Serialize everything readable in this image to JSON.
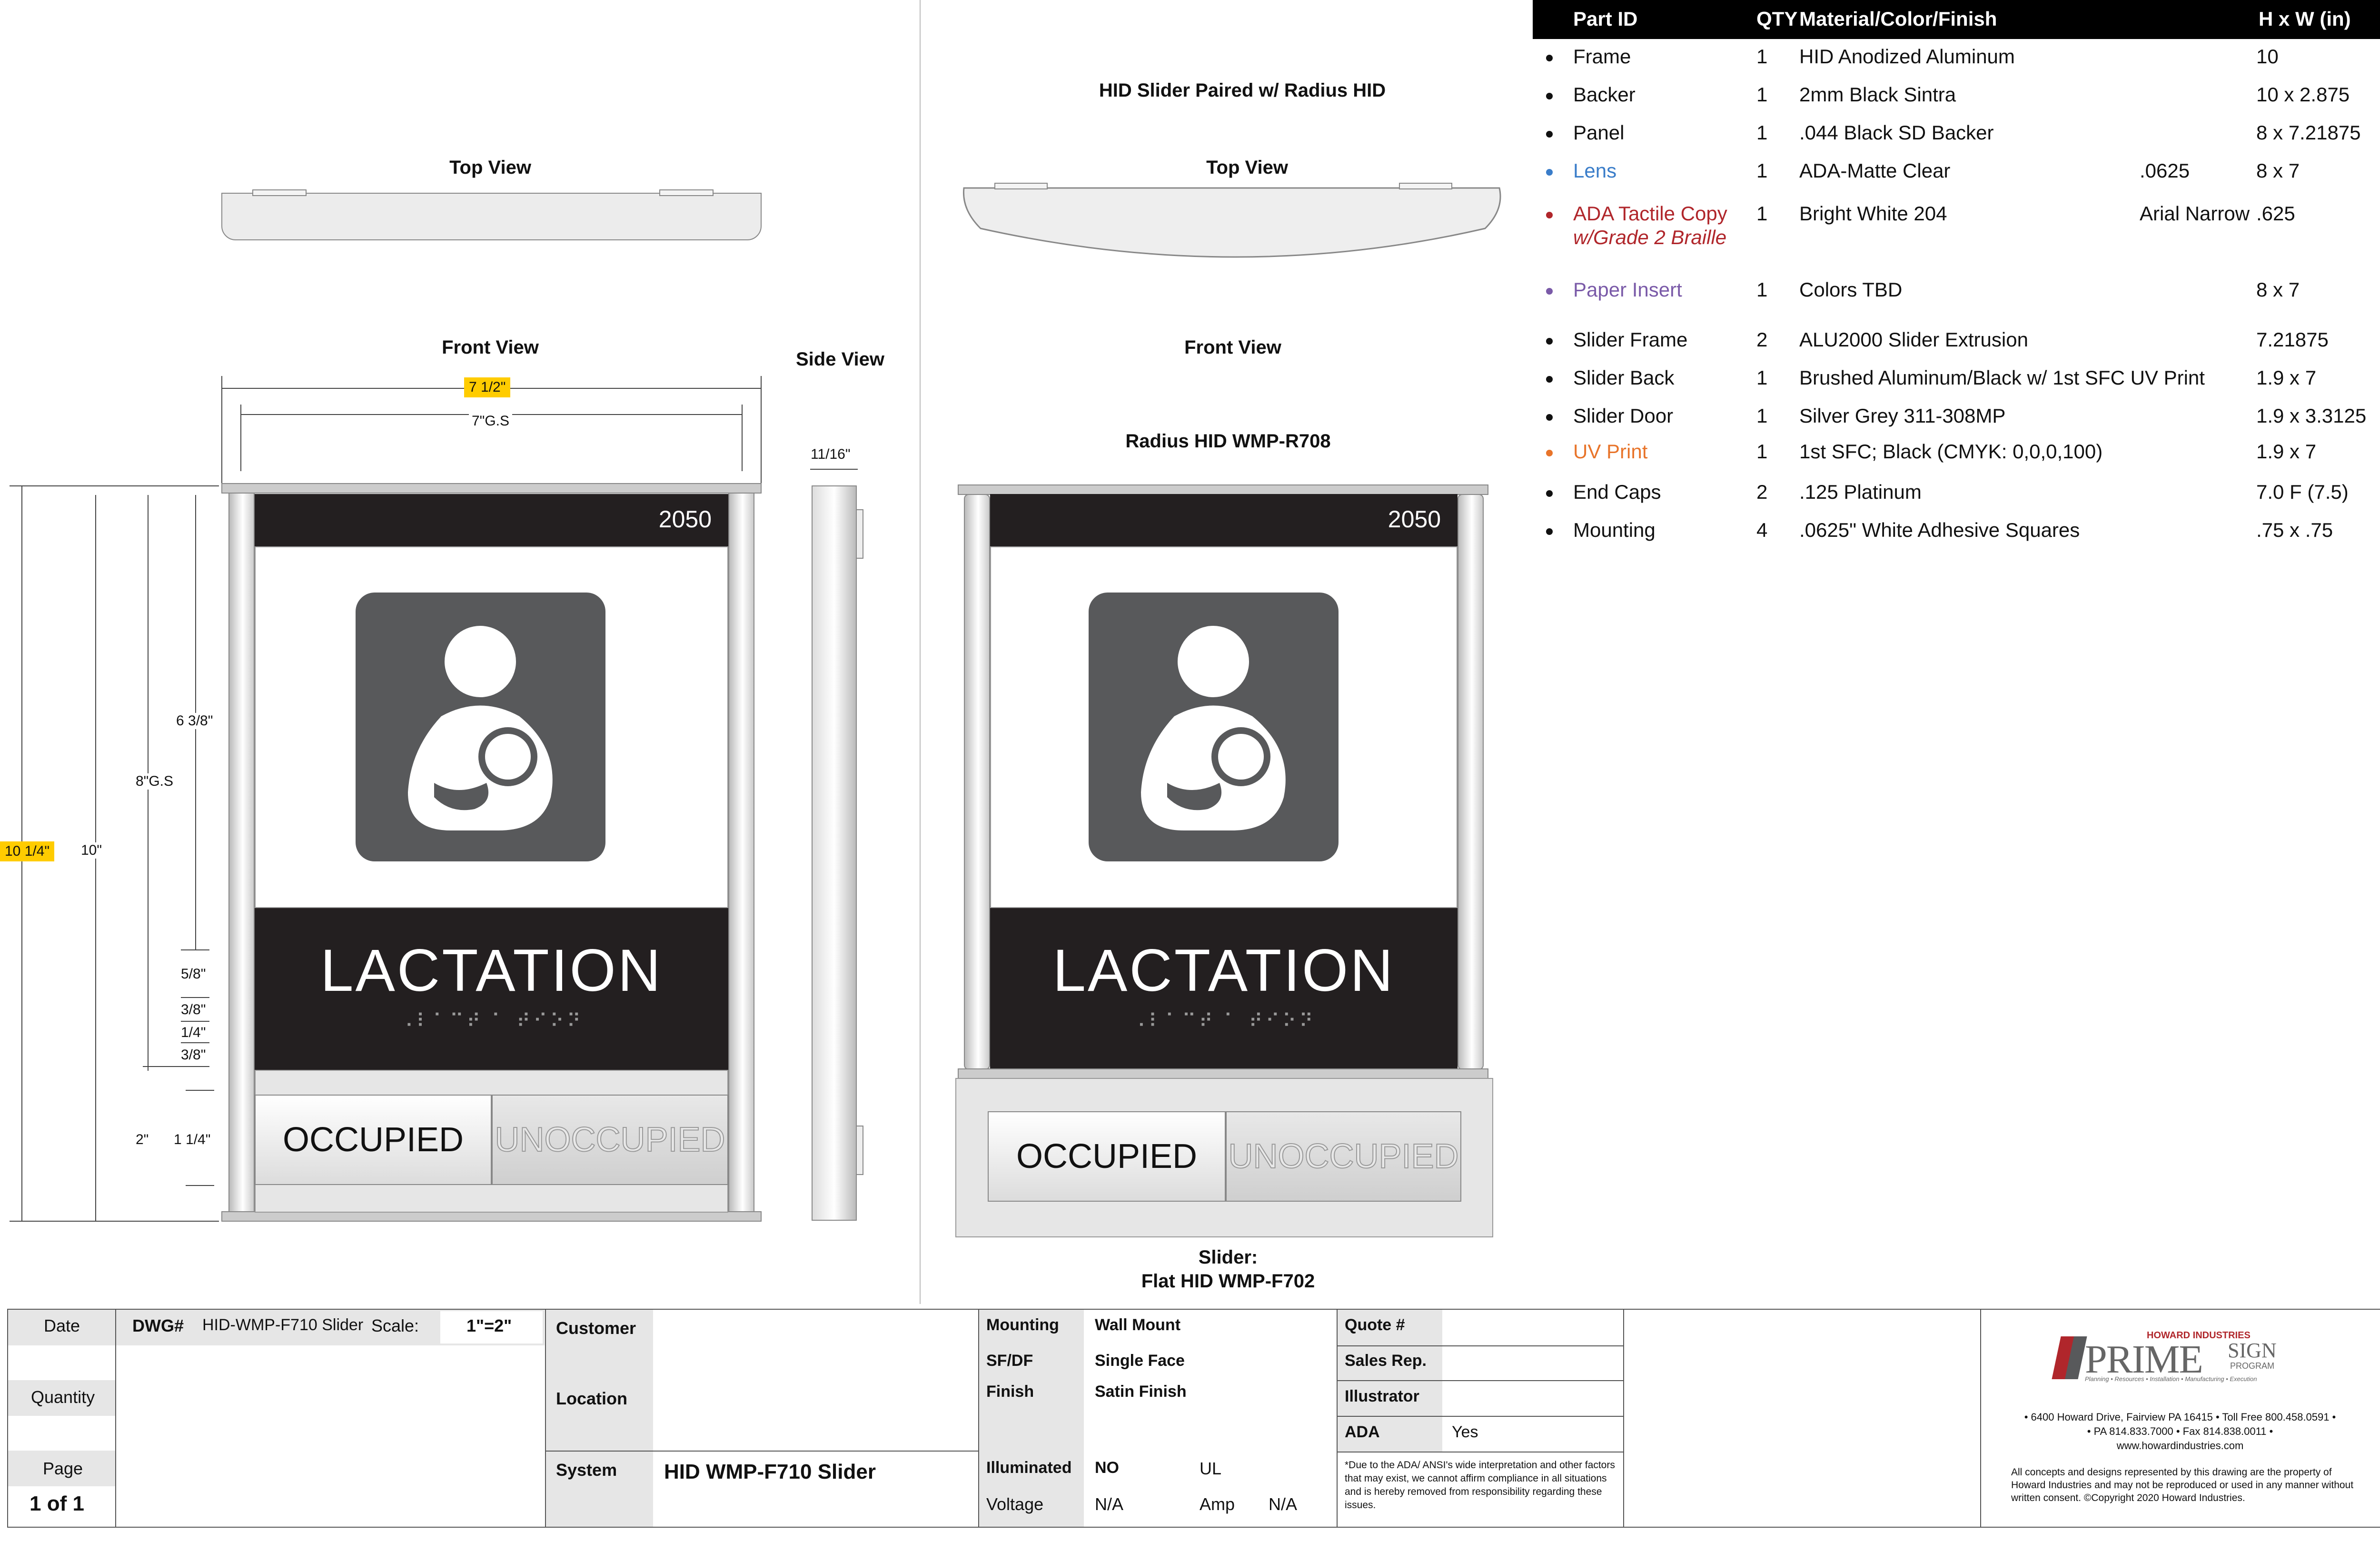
{
  "drawing": {
    "top_view_left": "Top View",
    "front_view_left": "Front View",
    "side_view": "Side View",
    "paired_title": "HID Slider Paired w/ Radius HID",
    "top_view_right": "Top View",
    "front_view_right": "Front View",
    "radius_title": "Radius HID WMP-R708",
    "slider_caption_1": "Slider:",
    "slider_caption_2": "Flat HID WMP-F702"
  },
  "dimensions": {
    "width_overall": "7 1/2\"",
    "width_gs": "7\"G.S",
    "side_depth": "11/16\"",
    "height_overall": "10 1/4\"",
    "height_10": "10\"",
    "height_gs": "8\"G.S",
    "d_6_3_8": "6 3/8\"",
    "d_5_8": "5/8\"",
    "d_3_8_a": "3/8\"",
    "d_1_4": "1/4\"",
    "d_3_8_b": "3/8\"",
    "d_2": "2\"",
    "d_1_1_4": "1 1/4\""
  },
  "sign": {
    "room_number": "2050",
    "room_name": "LACTATION",
    "braille": "⠠⠇⠁⠉⠞ ⠁ ⠞⠊⠕⠝",
    "occupied": "OCCUPIED",
    "unoccupied": "UNOCCUPIED",
    "icon": "breastfeeding-icon"
  },
  "parts_table": {
    "headers": {
      "part_id": "Part ID",
      "qty": "QTY",
      "material": "Material/Color/Finish",
      "size": "H x W (in)"
    },
    "rows": [
      {
        "part": "Frame",
        "qty": "1",
        "material": "HID Anodized Aluminum",
        "extra": "",
        "size": "10",
        "color": "#111111"
      },
      {
        "part": "Backer",
        "qty": "1",
        "material": "2mm Black Sintra",
        "extra": "",
        "size": "10 x 2.875",
        "color": "#111111"
      },
      {
        "part": "Panel",
        "qty": "1",
        "material": ".044 Black SD Backer",
        "extra": "",
        "size": "8 x 7.21875",
        "color": "#111111"
      },
      {
        "part": "Lens",
        "qty": "1",
        "material": "ADA-Matte Clear",
        "extra": ".0625",
        "size": "8 x 7",
        "color": "#3a7dc9"
      },
      {
        "part": "ADA Tactile Copy",
        "part2": "w/Grade 2 Braille",
        "qty": "1",
        "material": "Bright White 204",
        "extra": "Arial Narrow",
        "size": ".625",
        "color": "#b0262b"
      },
      {
        "part": "Paper Insert",
        "qty": "1",
        "material": "Colors TBD",
        "extra": "",
        "size": "8 x 7",
        "color": "#7a5aa8"
      },
      {
        "part": "Slider Frame",
        "qty": "2",
        "material": "ALU2000 Slider Extrusion",
        "extra": "",
        "size": "7.21875",
        "color": "#111111"
      },
      {
        "part": "Slider Back",
        "qty": "1",
        "material": "Brushed Aluminum/Black w/ 1st SFC UV Print",
        "extra": "",
        "size": "1.9 x 7",
        "color": "#111111"
      },
      {
        "part": "Slider Door",
        "qty": "1",
        "material": "Silver Grey 311-308MP",
        "extra": "",
        "size": "1.9 x 3.3125",
        "color": "#111111"
      },
      {
        "part": "UV Print",
        "qty": "1",
        "material": "1st SFC; Black (CMYK: 0,0,0,100)",
        "extra": "",
        "size": "1.9 x 7",
        "color": "#e8742a"
      },
      {
        "part": "End Caps",
        "qty": "2",
        "material": ".125 Platinum",
        "extra": "",
        "size": "7.0 F (7.5)",
        "color": "#111111"
      },
      {
        "part": "Mounting",
        "qty": "4",
        "material": ".0625\" White Adhesive Squares",
        "extra": "",
        "size": ".75 x .75",
        "color": "#111111"
      }
    ]
  },
  "title_block": {
    "date_label": "Date",
    "quantity_label": "Quantity",
    "page_label": "Page",
    "page_value": "1 of 1",
    "dwg_label": "DWG#",
    "dwg_value": "HID-WMP-F710 Slider",
    "scale_label": "Scale:",
    "scale_value": "1\"=2\"",
    "customer_label": "Customer",
    "location_label": "Location",
    "system_label": "System",
    "system_value": "HID  WMP-F710 Slider",
    "mounting_label": "Mounting",
    "mounting_value": "Wall Mount",
    "sfdf_label": "SF/DF",
    "sfdf_value": "Single Face",
    "finish_label": "Finish",
    "finish_value": "Satin Finish",
    "illuminated_label": "Illuminated",
    "illuminated_value": "NO",
    "ul_label": "UL",
    "voltage_label": "Voltage",
    "voltage_value": "N/A",
    "amp_label": "Amp",
    "amp_value": "N/A",
    "quote_label": "Quote #",
    "salesrep_label": "Sales Rep.",
    "illustrator_label": "Illustrator",
    "ada_label": "ADA",
    "ada_value": "Yes",
    "ada_note": "*Due to the ADA/ ANSI's wide interpretation and other factors that may exist, we cannot affirm compliance in all situations and is hereby removed from responsibility regarding these issues.",
    "logo_top": "HOWARD INDUSTRIES",
    "logo_main": "PRIME",
    "logo_sign": "SIGN",
    "logo_program": "PROGRAM",
    "logo_tagline": "Planning • Resources • Installation • Manufacturing • Execution",
    "address_1": "• 6400 Howard Drive, Fairview PA 16415 • Toll Free 800.458.0591 •",
    "address_2": "• PA 814.833.7000 • Fax 814.838.0011 •",
    "address_3": "www.howardindustries.com",
    "copyright": "All concepts and designs represented by this drawing are the property of Howard Industries and may not be reproduced or used in any manner without written consent. ©Copyright 2020 Howard Industries."
  }
}
